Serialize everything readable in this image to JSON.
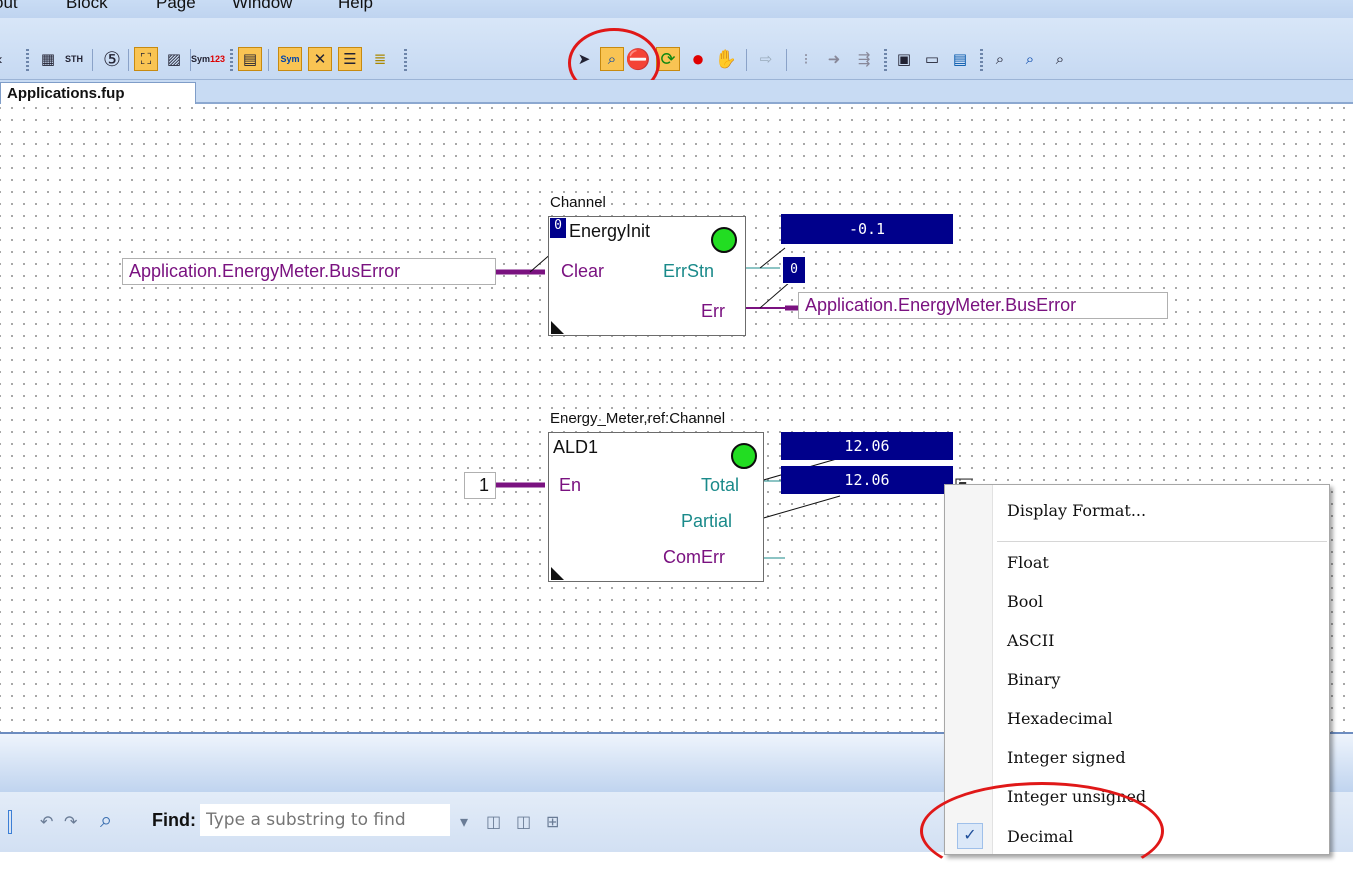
{
  "menu": [
    "out",
    "Block",
    "Page",
    "Window",
    "Help"
  ],
  "toolbar": {
    "sth_label": "STH",
    "sym_label": "Sym",
    "sym123_label": "123",
    "sym2_label": "Sym"
  },
  "tab": {
    "label": "Applications.fup"
  },
  "diagram": {
    "block1": {
      "title": "Channel",
      "name": "EnergyInit",
      "channel_value": "0",
      "inputs": [
        "Clear"
      ],
      "outputs": [
        "ErrStn",
        "Err"
      ],
      "value_top": "-0.1",
      "errstn_value": "0",
      "input_signal": "Application.EnergyMeter.BusError",
      "output_signal": "Application.EnergyMeter.BusError"
    },
    "block2": {
      "title": "Energy_Meter,ref:Channel",
      "name": "ALD1",
      "input_const": "1",
      "inputs": [
        "En"
      ],
      "outputs": [
        "Total",
        "Partial",
        "ComErr"
      ],
      "value_1": "12.06",
      "value_2": "12.06"
    }
  },
  "findbar": {
    "label": "Find:",
    "placeholder": "Type a substring to find"
  },
  "context_menu": {
    "display_format": "Display Format...",
    "items": [
      "Float",
      "Bool",
      "ASCII",
      "Binary",
      "Hexadecimal",
      "Integer signed",
      "Integer unsigned",
      "Decimal"
    ],
    "checked": "Decimal"
  },
  "colors": {
    "value_box": "#00008b",
    "input_pin": "#7a1280",
    "output_pin": "#1a8a8a",
    "led": "#22dd22",
    "highlight": "#e01818"
  }
}
